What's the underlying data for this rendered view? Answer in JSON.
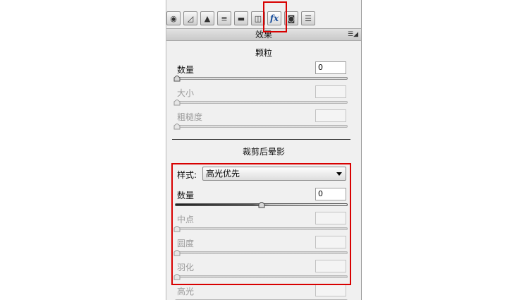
{
  "panel": {
    "header_title": "效果",
    "toolbar": [
      {
        "name": "basic-icon",
        "glyph": "◉"
      },
      {
        "name": "tone-curve-icon",
        "glyph": "◿"
      },
      {
        "name": "detail-icon",
        "glyph": "▲"
      },
      {
        "name": "hsl-icon",
        "glyph": "≡"
      },
      {
        "name": "split-toning-icon",
        "glyph": "▬"
      },
      {
        "name": "lens-corrections-icon",
        "glyph": "◫"
      },
      {
        "name": "effects-icon",
        "glyph": "fx"
      },
      {
        "name": "camera-calibration-icon",
        "glyph": "◙"
      },
      {
        "name": "presets-icon",
        "glyph": "☰"
      }
    ],
    "grain": {
      "title": "颗粒",
      "amount_label": "数量",
      "amount_value": "0",
      "size_label": "大小",
      "roughness_label": "粗糙度"
    },
    "vignette": {
      "title": "裁剪后晕影",
      "style_label": "样式:",
      "style_value": "高光优先",
      "amount_label": "数量",
      "amount_value": "0",
      "amount_level": 0.5,
      "midpoint_label": "中点",
      "roundness_label": "圆度",
      "feather_label": "羽化",
      "highlights_label": "高光"
    }
  },
  "colors": {
    "highlight_box": "#d80000"
  }
}
